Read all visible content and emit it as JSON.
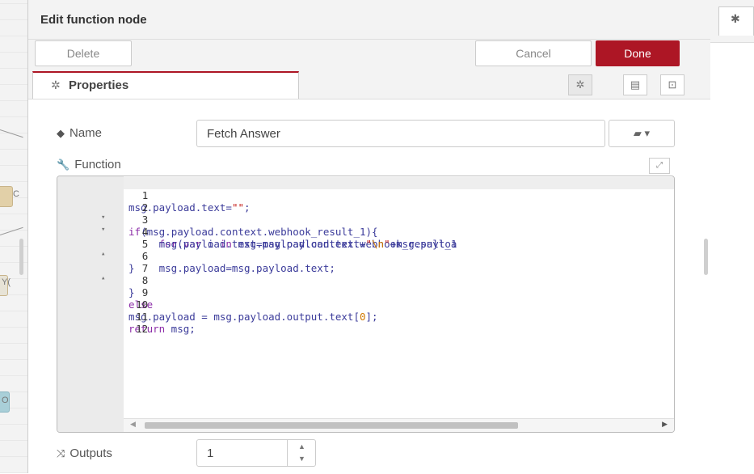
{
  "tray": {
    "title": "Edit function node",
    "delete_label": "Delete",
    "cancel_label": "Cancel",
    "done_label": "Done",
    "done_color": "#ad1625"
  },
  "tabs": {
    "properties_label": "Properties",
    "properties_icon": "gear-icon",
    "buttons": [
      "gear-icon",
      "description-icon",
      "appearance-icon"
    ]
  },
  "form": {
    "name_label": "Name",
    "name_value": "Fetch Answer",
    "name_icon": "tag-icon",
    "function_label": "Function",
    "function_icon": "wrench-icon",
    "outputs_label": "Outputs",
    "outputs_icon": "shuffle-icon",
    "outputs_value": "1"
  },
  "code": {
    "line_numbers": [
      "1",
      "2",
      "3",
      "4",
      "5",
      "6",
      "7",
      "8",
      "9",
      "10",
      "11",
      "12"
    ],
    "fold_markers": [
      "",
      "▾",
      "▾",
      "",
      "▴",
      "",
      "▴",
      "",
      "",
      "",
      "",
      ""
    ]
  },
  "canvas": {
    "visible_fragments": [
      "C",
      "Y(",
      "O"
    ]
  }
}
